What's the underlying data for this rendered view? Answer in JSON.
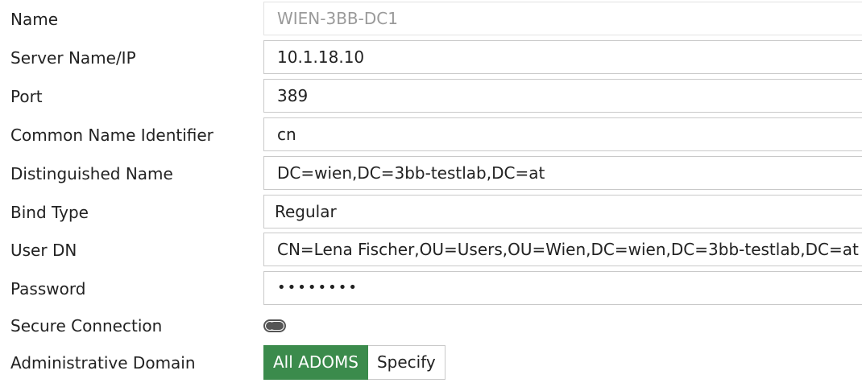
{
  "form": {
    "name": {
      "label": "Name",
      "value": "WIEN-3BB-DC1"
    },
    "server": {
      "label": "Server Name/IP",
      "value": "10.1.18.10"
    },
    "port": {
      "label": "Port",
      "value": "389"
    },
    "cn_identifier": {
      "label": "Common Name Identifier",
      "value": "cn"
    },
    "distinguished_name": {
      "label": "Distinguished Name",
      "value": "DC=wien,DC=3bb-testlab,DC=at"
    },
    "bind_type": {
      "label": "Bind Type",
      "value": "Regular"
    },
    "user_dn": {
      "label": "User DN",
      "value": "CN=Lena Fischer,OU=Users,OU=Wien,DC=wien,DC=3bb-testlab,DC=at"
    },
    "password": {
      "label": "Password",
      "value": "••••••••"
    },
    "secure_connection": {
      "label": "Secure Connection",
      "enabled": false
    },
    "admin_domain": {
      "label": "Administrative Domain",
      "options": [
        "All ADOMS",
        "Specify"
      ],
      "selected": "All ADOMS"
    }
  },
  "colors": {
    "accent": "#3b8b4c",
    "border": "#c9c9c9",
    "disabled_text": "#9a9a9a",
    "text": "#222222"
  },
  "icons": {
    "secure_connection_toggle": "toggle-switch-off"
  }
}
